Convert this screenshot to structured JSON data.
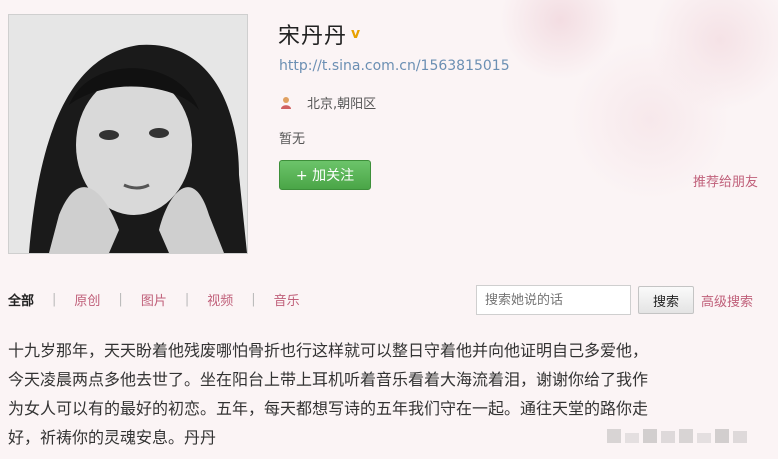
{
  "profile": {
    "name": "宋丹丹",
    "verified_icon": "verified-v-icon",
    "url": "http://t.sina.com.cn/1563815015",
    "location_icon": "person-location-icon",
    "location": "北京,朝阳区",
    "bio": "暂无",
    "follow_label": "+ 加关注",
    "recommend_label": "推荐给朋友"
  },
  "tabs": [
    {
      "label": "全部",
      "active": true
    },
    {
      "label": "原创"
    },
    {
      "label": "图片"
    },
    {
      "label": "视频"
    },
    {
      "label": "音乐"
    }
  ],
  "search": {
    "placeholder": "搜索她说的话",
    "button_label": "搜索",
    "advanced_label": "高级搜索"
  },
  "post": {
    "lines": [
      "十九岁那年，天天盼着他残废哪怕骨折也行这样就可以整日守着他并向他证明自己多爱他，",
      "今天凌晨两点多他去世了。坐在阳台上带上耳机听着音乐看着大海流着泪，谢谢你给了我作",
      "为女人可以有的最好的初恋。五年，每天都想写诗的五年我们守在一起。通往天堂的路你走",
      "好，祈祷你的灵魂安息。丹丹"
    ]
  },
  "colors": {
    "link_pink": "#c0607a",
    "url_blue": "#6b8fb3",
    "follow_green": "#4aa547"
  }
}
